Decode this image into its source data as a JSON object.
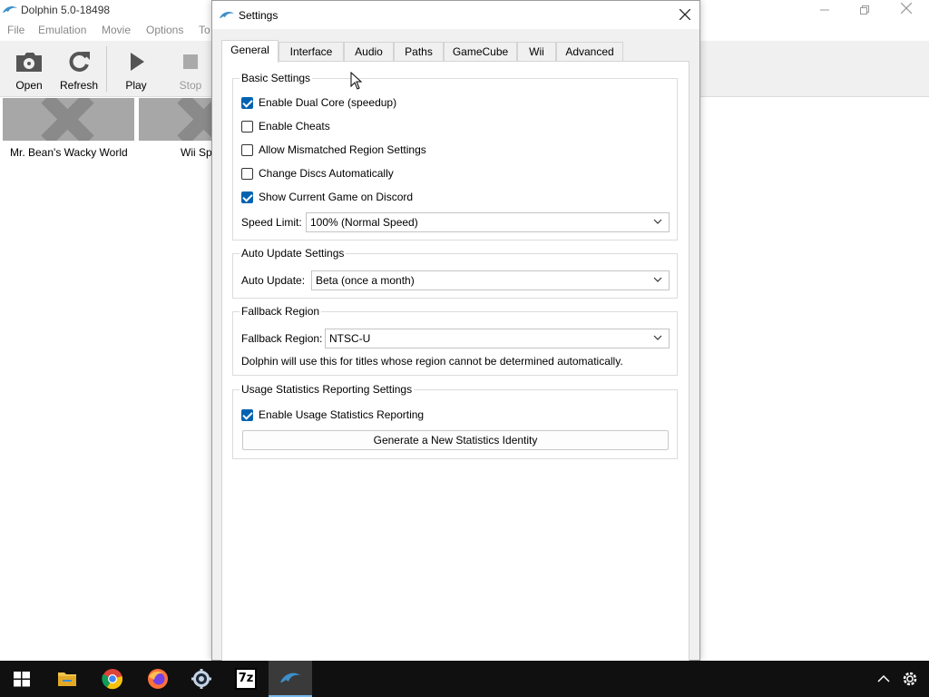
{
  "main_window": {
    "title": "Dolphin 5.0-18498",
    "menu": [
      "File",
      "Emulation",
      "Movie",
      "Options",
      "To"
    ],
    "toolbar": {
      "open_label": "Open",
      "refresh_label": "Refresh",
      "play_label": "Play",
      "stop_label": "Stop"
    },
    "games": [
      {
        "title": "Mr. Bean's Wacky World"
      },
      {
        "title": "Wii Sp"
      }
    ]
  },
  "settings": {
    "title": "Settings",
    "tabs": [
      "General",
      "Interface",
      "Audio",
      "Paths",
      "GameCube",
      "Wii",
      "Advanced"
    ],
    "active_tab": "General",
    "basic": {
      "legend": "Basic Settings",
      "dual_core": {
        "label": "Enable Dual Core (speedup)",
        "checked": true
      },
      "cheats": {
        "label": "Enable Cheats",
        "checked": false
      },
      "mismatched_region": {
        "label": "Allow Mismatched Region Settings",
        "checked": false
      },
      "change_discs": {
        "label": "Change Discs Automatically",
        "checked": false
      },
      "discord": {
        "label": "Show Current Game on Discord",
        "checked": true
      },
      "speed_limit_label": "Speed Limit:",
      "speed_limit_value": "100% (Normal Speed)"
    },
    "auto_update": {
      "legend": "Auto Update Settings",
      "label": "Auto Update:",
      "value": "Beta (once a month)"
    },
    "fallback": {
      "legend": "Fallback Region",
      "label": "Fallback Region:",
      "value": "NTSC-U",
      "description": "Dolphin will use this for titles whose region cannot be determined automatically."
    },
    "usage_stats": {
      "legend": "Usage Statistics Reporting Settings",
      "enable": {
        "label": "Enable Usage Statistics Reporting",
        "checked": true
      },
      "generate_button": "Generate a New Statistics Identity"
    }
  },
  "taskbar": {
    "apps": [
      "start-icon",
      "file-explorer-icon",
      "chrome-icon",
      "firefox-icon",
      "steam-icon",
      "7zip-icon",
      "dolphin-icon"
    ],
    "seven_zip_text": "7z",
    "accent": "#76b9ed"
  },
  "colors": {
    "checkbox_accent": "#0063b1",
    "taskbar_bg": "#101010"
  }
}
